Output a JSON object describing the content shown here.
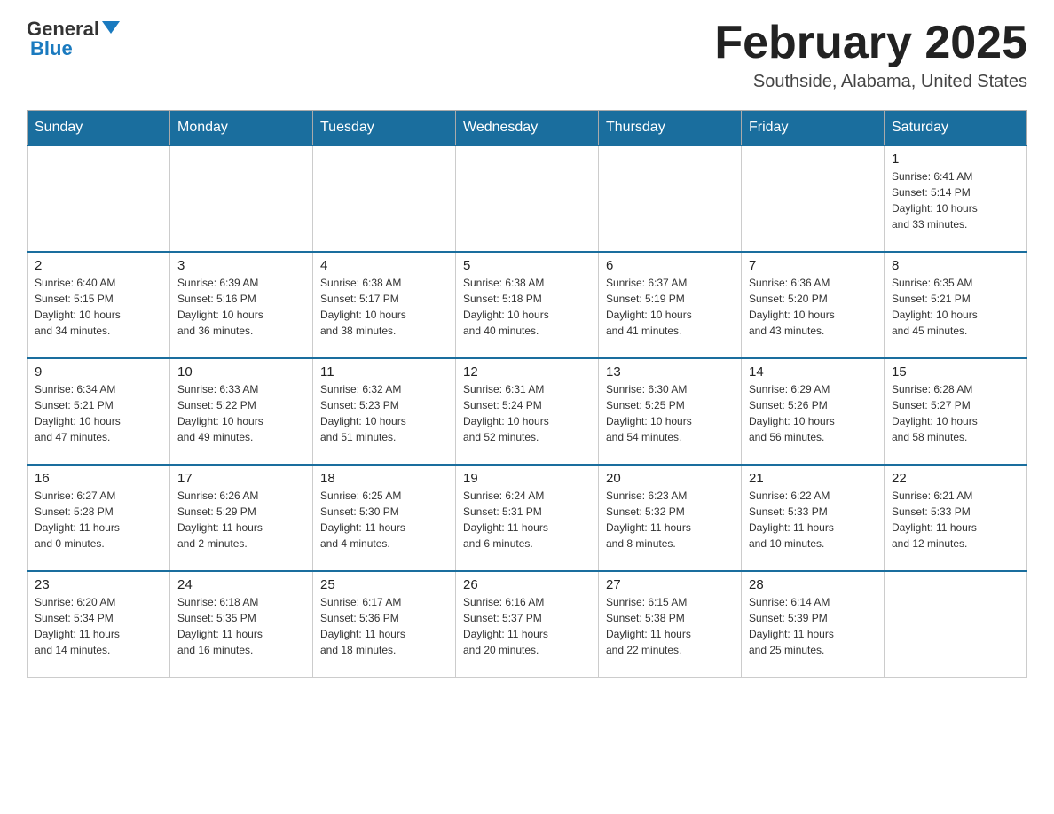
{
  "header": {
    "logo_general": "General",
    "logo_blue": "Blue",
    "title": "February 2025",
    "location": "Southside, Alabama, United States"
  },
  "days_of_week": [
    "Sunday",
    "Monday",
    "Tuesday",
    "Wednesday",
    "Thursday",
    "Friday",
    "Saturday"
  ],
  "weeks": [
    [
      {
        "day": "",
        "info": ""
      },
      {
        "day": "",
        "info": ""
      },
      {
        "day": "",
        "info": ""
      },
      {
        "day": "",
        "info": ""
      },
      {
        "day": "",
        "info": ""
      },
      {
        "day": "",
        "info": ""
      },
      {
        "day": "1",
        "info": "Sunrise: 6:41 AM\nSunset: 5:14 PM\nDaylight: 10 hours\nand 33 minutes."
      }
    ],
    [
      {
        "day": "2",
        "info": "Sunrise: 6:40 AM\nSunset: 5:15 PM\nDaylight: 10 hours\nand 34 minutes."
      },
      {
        "day": "3",
        "info": "Sunrise: 6:39 AM\nSunset: 5:16 PM\nDaylight: 10 hours\nand 36 minutes."
      },
      {
        "day": "4",
        "info": "Sunrise: 6:38 AM\nSunset: 5:17 PM\nDaylight: 10 hours\nand 38 minutes."
      },
      {
        "day": "5",
        "info": "Sunrise: 6:38 AM\nSunset: 5:18 PM\nDaylight: 10 hours\nand 40 minutes."
      },
      {
        "day": "6",
        "info": "Sunrise: 6:37 AM\nSunset: 5:19 PM\nDaylight: 10 hours\nand 41 minutes."
      },
      {
        "day": "7",
        "info": "Sunrise: 6:36 AM\nSunset: 5:20 PM\nDaylight: 10 hours\nand 43 minutes."
      },
      {
        "day": "8",
        "info": "Sunrise: 6:35 AM\nSunset: 5:21 PM\nDaylight: 10 hours\nand 45 minutes."
      }
    ],
    [
      {
        "day": "9",
        "info": "Sunrise: 6:34 AM\nSunset: 5:21 PM\nDaylight: 10 hours\nand 47 minutes."
      },
      {
        "day": "10",
        "info": "Sunrise: 6:33 AM\nSunset: 5:22 PM\nDaylight: 10 hours\nand 49 minutes."
      },
      {
        "day": "11",
        "info": "Sunrise: 6:32 AM\nSunset: 5:23 PM\nDaylight: 10 hours\nand 51 minutes."
      },
      {
        "day": "12",
        "info": "Sunrise: 6:31 AM\nSunset: 5:24 PM\nDaylight: 10 hours\nand 52 minutes."
      },
      {
        "day": "13",
        "info": "Sunrise: 6:30 AM\nSunset: 5:25 PM\nDaylight: 10 hours\nand 54 minutes."
      },
      {
        "day": "14",
        "info": "Sunrise: 6:29 AM\nSunset: 5:26 PM\nDaylight: 10 hours\nand 56 minutes."
      },
      {
        "day": "15",
        "info": "Sunrise: 6:28 AM\nSunset: 5:27 PM\nDaylight: 10 hours\nand 58 minutes."
      }
    ],
    [
      {
        "day": "16",
        "info": "Sunrise: 6:27 AM\nSunset: 5:28 PM\nDaylight: 11 hours\nand 0 minutes."
      },
      {
        "day": "17",
        "info": "Sunrise: 6:26 AM\nSunset: 5:29 PM\nDaylight: 11 hours\nand 2 minutes."
      },
      {
        "day": "18",
        "info": "Sunrise: 6:25 AM\nSunset: 5:30 PM\nDaylight: 11 hours\nand 4 minutes."
      },
      {
        "day": "19",
        "info": "Sunrise: 6:24 AM\nSunset: 5:31 PM\nDaylight: 11 hours\nand 6 minutes."
      },
      {
        "day": "20",
        "info": "Sunrise: 6:23 AM\nSunset: 5:32 PM\nDaylight: 11 hours\nand 8 minutes."
      },
      {
        "day": "21",
        "info": "Sunrise: 6:22 AM\nSunset: 5:33 PM\nDaylight: 11 hours\nand 10 minutes."
      },
      {
        "day": "22",
        "info": "Sunrise: 6:21 AM\nSunset: 5:33 PM\nDaylight: 11 hours\nand 12 minutes."
      }
    ],
    [
      {
        "day": "23",
        "info": "Sunrise: 6:20 AM\nSunset: 5:34 PM\nDaylight: 11 hours\nand 14 minutes."
      },
      {
        "day": "24",
        "info": "Sunrise: 6:18 AM\nSunset: 5:35 PM\nDaylight: 11 hours\nand 16 minutes."
      },
      {
        "day": "25",
        "info": "Sunrise: 6:17 AM\nSunset: 5:36 PM\nDaylight: 11 hours\nand 18 minutes."
      },
      {
        "day": "26",
        "info": "Sunrise: 6:16 AM\nSunset: 5:37 PM\nDaylight: 11 hours\nand 20 minutes."
      },
      {
        "day": "27",
        "info": "Sunrise: 6:15 AM\nSunset: 5:38 PM\nDaylight: 11 hours\nand 22 minutes."
      },
      {
        "day": "28",
        "info": "Sunrise: 6:14 AM\nSunset: 5:39 PM\nDaylight: 11 hours\nand 25 minutes."
      },
      {
        "day": "",
        "info": ""
      }
    ]
  ]
}
